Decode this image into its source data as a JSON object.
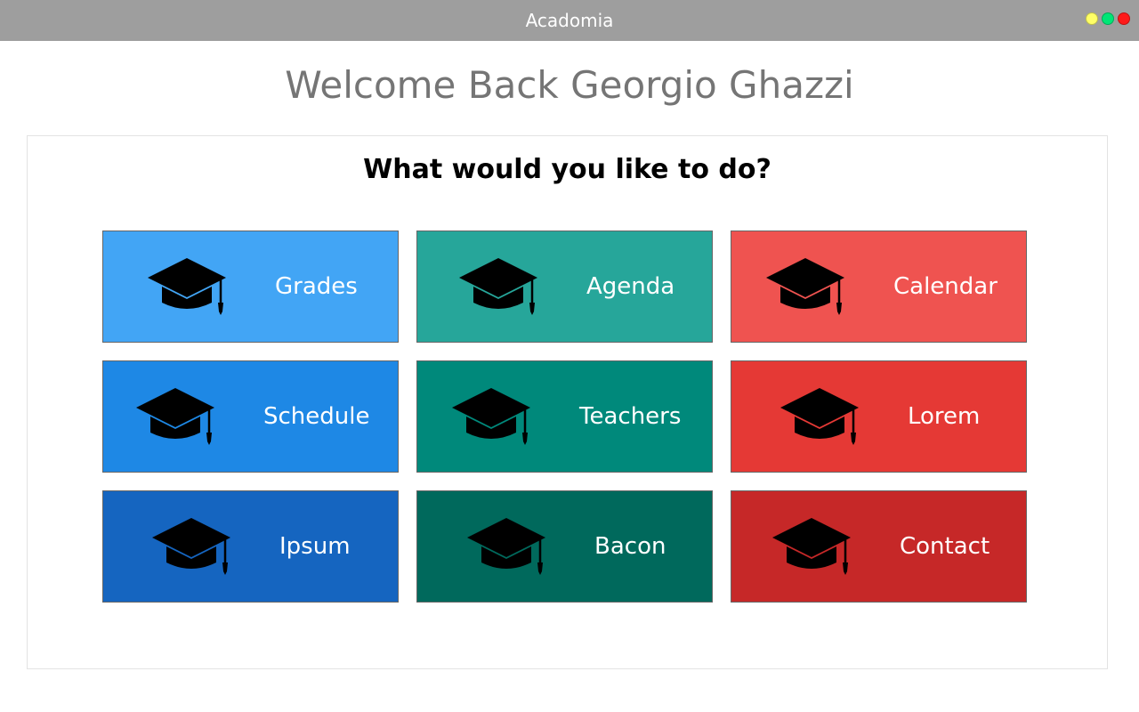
{
  "window": {
    "title": "Acadomia",
    "controls": [
      {
        "name": "minimize",
        "color": "#ffff66"
      },
      {
        "name": "maximize",
        "color": "#00e676"
      },
      {
        "name": "close",
        "color": "#ff1a1a"
      }
    ]
  },
  "welcome": "Welcome Back Georgio Ghazzi",
  "prompt": "What would you like to do?",
  "tiles": [
    {
      "label": "Grades",
      "color": "#42a5f5",
      "icon": "graduation-cap-icon"
    },
    {
      "label": "Agenda",
      "color": "#26a69a",
      "icon": "graduation-cap-icon"
    },
    {
      "label": "Calendar",
      "color": "#ef5350",
      "icon": "graduation-cap-icon"
    },
    {
      "label": "Schedule",
      "color": "#1e88e5",
      "icon": "graduation-cap-icon"
    },
    {
      "label": "Teachers",
      "color": "#00897b",
      "icon": "graduation-cap-icon"
    },
    {
      "label": "Lorem",
      "color": "#e53935",
      "icon": "graduation-cap-icon"
    },
    {
      "label": "Ipsum",
      "color": "#1565c0",
      "icon": "graduation-cap-icon"
    },
    {
      "label": "Bacon",
      "color": "#00695c",
      "icon": "graduation-cap-icon"
    },
    {
      "label": "Contact",
      "color": "#c62828",
      "icon": "graduation-cap-icon"
    }
  ]
}
